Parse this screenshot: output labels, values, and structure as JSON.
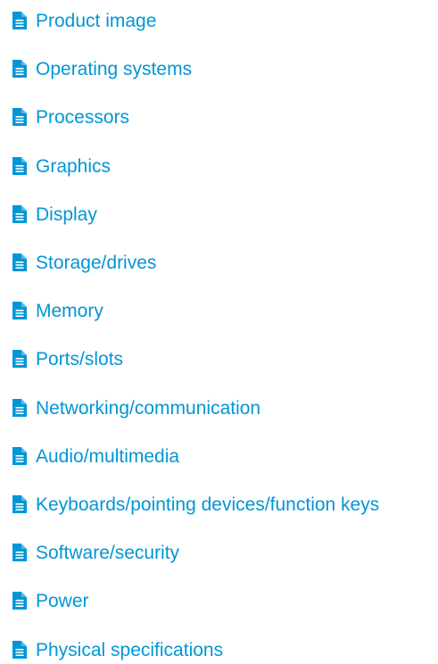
{
  "colors": {
    "link": "#0096d6",
    "background": "#ffffff"
  },
  "icon": "document-icon",
  "links": [
    {
      "label": "Product image"
    },
    {
      "label": "Operating systems"
    },
    {
      "label": "Processors"
    },
    {
      "label": "Graphics"
    },
    {
      "label": "Display"
    },
    {
      "label": "Storage/drives"
    },
    {
      "label": "Memory"
    },
    {
      "label": "Ports/slots"
    },
    {
      "label": "Networking/communication"
    },
    {
      "label": "Audio/multimedia"
    },
    {
      "label": "Keyboards/pointing devices/function keys"
    },
    {
      "label": "Software/security"
    },
    {
      "label": "Power"
    },
    {
      "label": "Physical specifications"
    }
  ]
}
